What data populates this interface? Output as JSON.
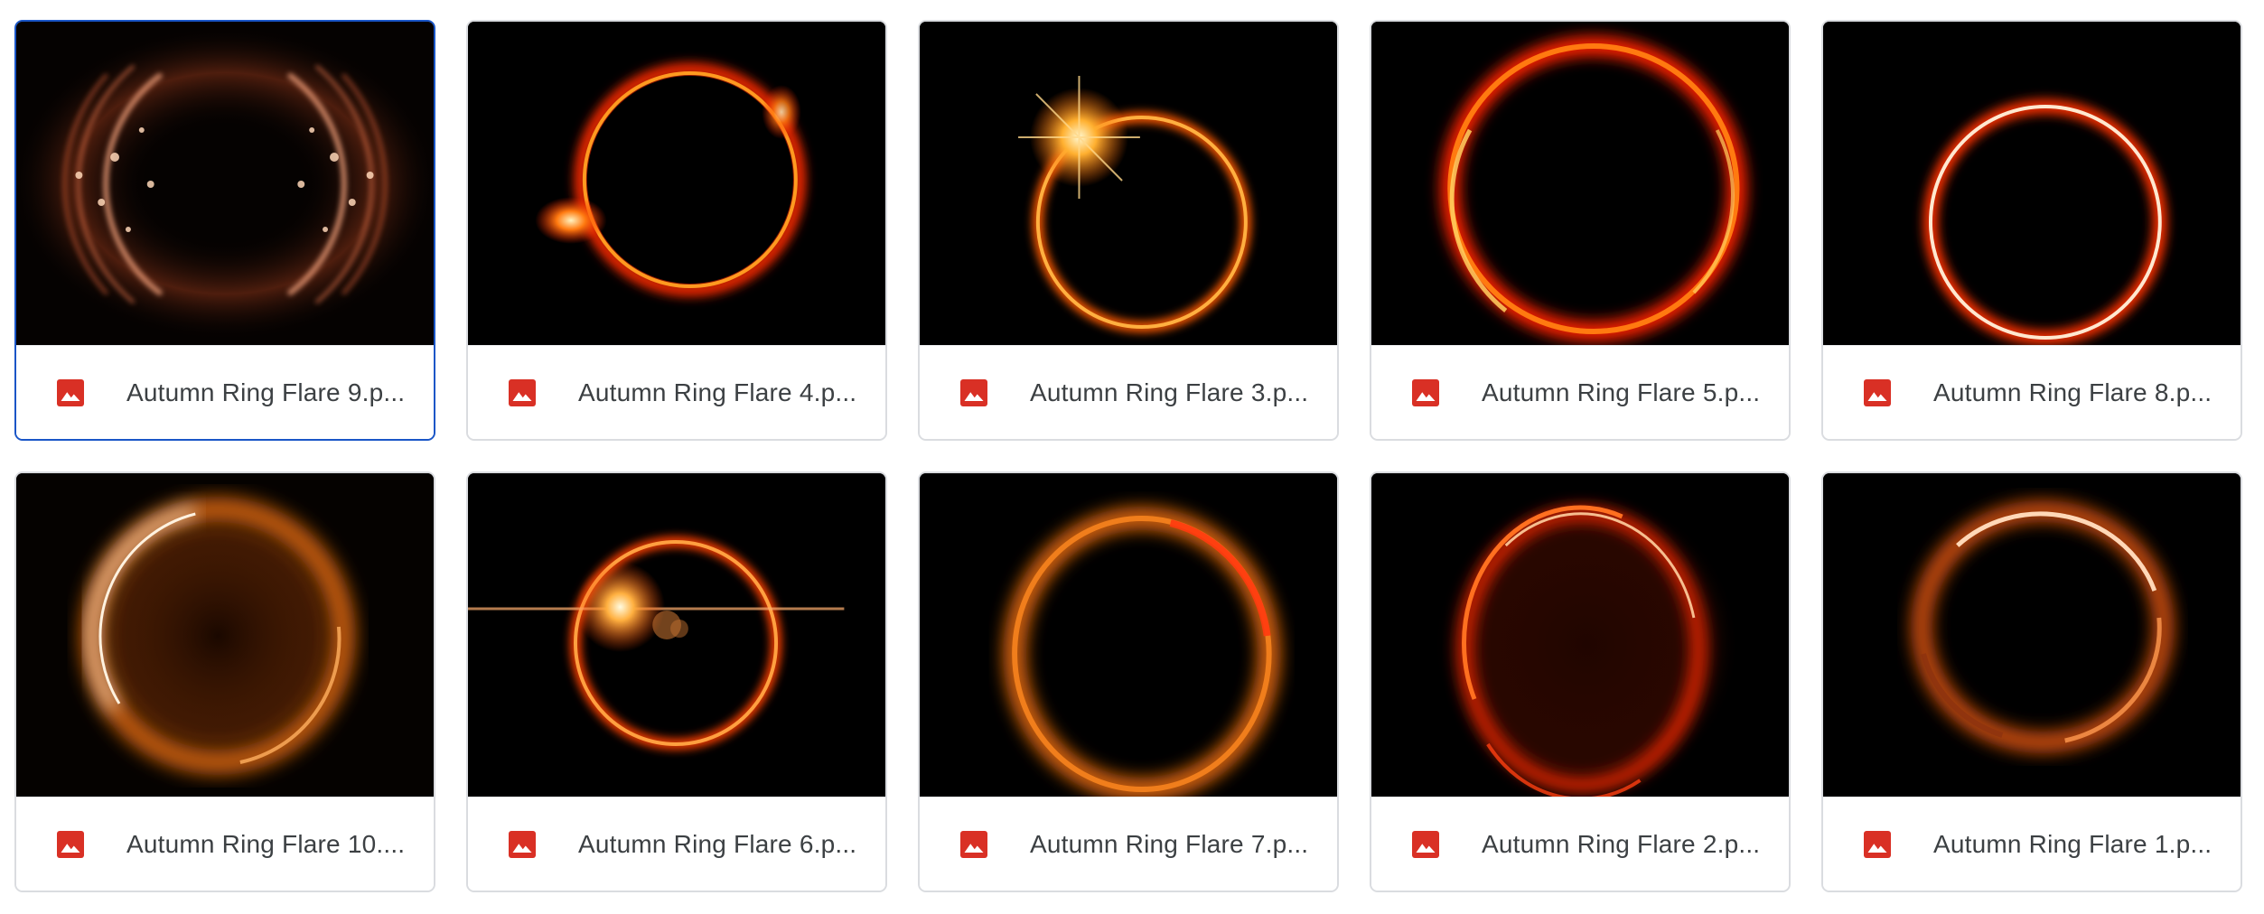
{
  "colors": {
    "selected_border": "#1a56c7",
    "card_border": "#dadce0",
    "image_icon": "#d93025",
    "text": "#3c4043"
  },
  "files": [
    {
      "name": "Autumn Ring Flare 9.p...",
      "icon": "image-file-icon",
      "selected": true
    },
    {
      "name": "Autumn Ring Flare 4.p...",
      "icon": "image-file-icon",
      "selected": false
    },
    {
      "name": "Autumn Ring Flare 3.p...",
      "icon": "image-file-icon",
      "selected": false
    },
    {
      "name": "Autumn Ring Flare 5.p...",
      "icon": "image-file-icon",
      "selected": false
    },
    {
      "name": "Autumn Ring Flare 8.p...",
      "icon": "image-file-icon",
      "selected": false
    },
    {
      "name": "Autumn Ring Flare 10....",
      "icon": "image-file-icon",
      "selected": false
    },
    {
      "name": "Autumn Ring Flare 6.p...",
      "icon": "image-file-icon",
      "selected": false
    },
    {
      "name": "Autumn Ring Flare 7.p...",
      "icon": "image-file-icon",
      "selected": false
    },
    {
      "name": "Autumn Ring Flare 2.p...",
      "icon": "image-file-icon",
      "selected": false
    },
    {
      "name": "Autumn Ring Flare 1.p...",
      "icon": "image-file-icon",
      "selected": false
    }
  ]
}
